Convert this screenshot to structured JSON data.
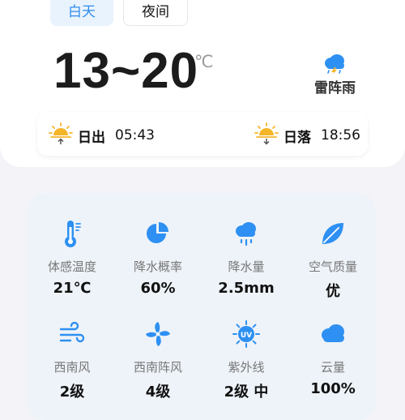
{
  "tabs": [
    {
      "label": "白天"
    },
    {
      "label": "夜间"
    }
  ],
  "forecast": {
    "temp_range": "13~20",
    "unit": "℃",
    "condition": "雷阵雨",
    "condition_icon": "thunderstorm-icon"
  },
  "sun": {
    "sunrise_label": "日出",
    "sunrise_time": "05:43",
    "sunset_label": "日落",
    "sunset_time": "18:56"
  },
  "details": [
    {
      "label": "体感温度",
      "value": "21℃",
      "icon": "thermometer-icon"
    },
    {
      "label": "降水概率",
      "value": "60%",
      "icon": "pie-chart-icon"
    },
    {
      "label": "降水量",
      "value": "2.5mm",
      "icon": "rain-cloud-icon"
    },
    {
      "label": "空气质量",
      "value": "优",
      "icon": "leaf-icon"
    },
    {
      "label": "西南风",
      "value": "2级",
      "icon": "wind-icon"
    },
    {
      "label": "西南阵风",
      "value": "4级",
      "icon": "fan-icon"
    },
    {
      "label": "紫外线",
      "value": "2级 中",
      "icon": "uv-icon"
    },
    {
      "label": "云量",
      "value": "100%",
      "icon": "cloud-icon"
    }
  ],
  "colors": {
    "accent": "#2f8cec",
    "sun": "#f5b52a",
    "icon_blue": "#2e90f2"
  }
}
